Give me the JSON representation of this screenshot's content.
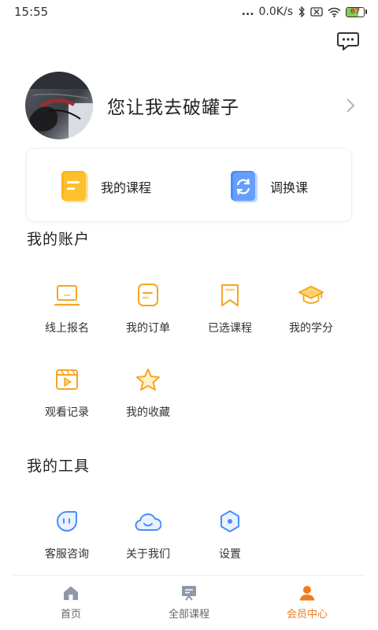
{
  "status_bar": {
    "time": "15:55",
    "dots": "...",
    "speed": "0.0K/s",
    "battery": "67"
  },
  "header": {
    "message_icon": "chat-bubble-icon"
  },
  "profile": {
    "username": "您让我去破罐子",
    "avatar": "avatar-photo"
  },
  "quick_links": [
    {
      "label": "我的课程",
      "icon": "document-icon",
      "color": "#FDB515"
    },
    {
      "label": "调换课",
      "icon": "refresh-icon",
      "color": "#4A8DF8"
    }
  ],
  "account": {
    "title": "我的账户",
    "items": [
      {
        "label": "线上报名",
        "icon": "laptop-icon"
      },
      {
        "label": "我的订单",
        "icon": "order-icon"
      },
      {
        "label": "已选课程",
        "icon": "bookmark-icon"
      },
      {
        "label": "我的学分",
        "icon": "graduation-cap-icon"
      },
      {
        "label": "观看记录",
        "icon": "video-history-icon"
      },
      {
        "label": "我的收藏",
        "icon": "star-icon"
      }
    ]
  },
  "tools": {
    "title": "我的工具",
    "items": [
      {
        "label": "客服咨询",
        "icon": "customer-service-icon"
      },
      {
        "label": "关于我们",
        "icon": "cloud-smile-icon"
      },
      {
        "label": "设置",
        "icon": "settings-icon"
      }
    ]
  },
  "tabbar": {
    "items": [
      {
        "label": "首页",
        "icon": "home-icon"
      },
      {
        "label": "全部课程",
        "icon": "courses-board-icon"
      },
      {
        "label": "会员中心",
        "icon": "user-icon"
      }
    ],
    "active_color": "#F07B1C"
  },
  "colors": {
    "accent_yellow": "#F5A623",
    "accent_blue": "#4A8DF8",
    "tab_active": "#F07B1C"
  }
}
